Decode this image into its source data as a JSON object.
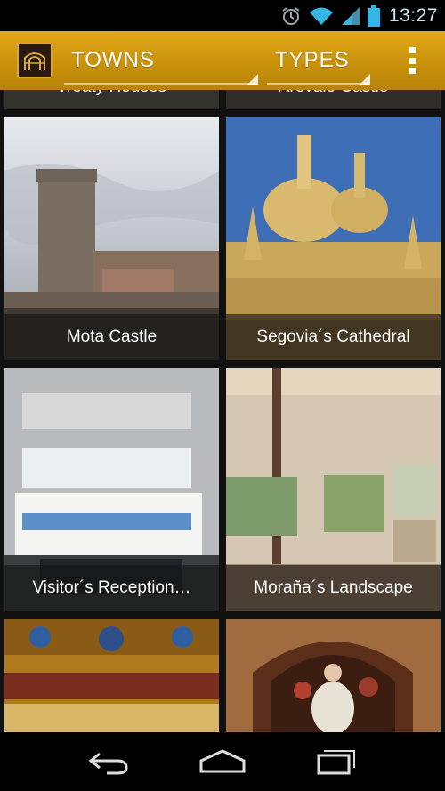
{
  "status_bar": {
    "time": "13:27",
    "icons": [
      "alarm-icon",
      "wifi-icon",
      "signal-icon",
      "battery-icon"
    ]
  },
  "action_bar": {
    "towns_label": "TOWNS",
    "types_label": "TYPES",
    "accent_color": "#c9920b"
  },
  "grid": {
    "partial_top": [
      "Treaty Houses",
      "Arevalo Castle"
    ],
    "tiles": [
      {
        "caption": "Mota Castle"
      },
      {
        "caption": "Segovia´s Cathedral"
      },
      {
        "caption": "Visitor´s Reception…"
      },
      {
        "caption": "Moraña´s Landscape"
      }
    ]
  },
  "nav_bar": {
    "buttons": [
      "back-icon",
      "home-icon",
      "recent-apps-icon"
    ]
  }
}
